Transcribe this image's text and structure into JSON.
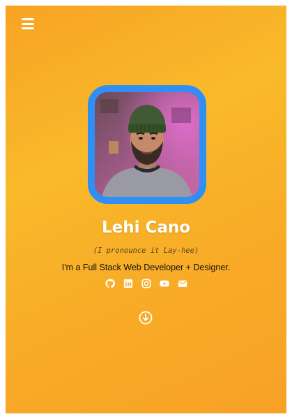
{
  "profile": {
    "name": "Lehi Cano",
    "pronunciation": "(I pronounce it Lay-hee)",
    "tagline": "I'm a Full Stack Web Developer + Designer."
  },
  "nav": {
    "menu_icon": "hamburger-menu-icon"
  },
  "socials": [
    {
      "icon": "github-icon"
    },
    {
      "icon": "linkedin-icon"
    },
    {
      "icon": "instagram-icon"
    },
    {
      "icon": "youtube-icon"
    },
    {
      "icon": "envelope-icon"
    }
  ],
  "scroll": {
    "icon": "arrow-circle-down-icon"
  },
  "colors": {
    "background_gradient_start": "#f7a324",
    "background_gradient_mid": "#f9ba2a",
    "avatar_border": "#2f8ff5",
    "avatar_shadow": "#1b1b1b",
    "name_text": "#ffffff",
    "tagline_text": "#111111"
  }
}
